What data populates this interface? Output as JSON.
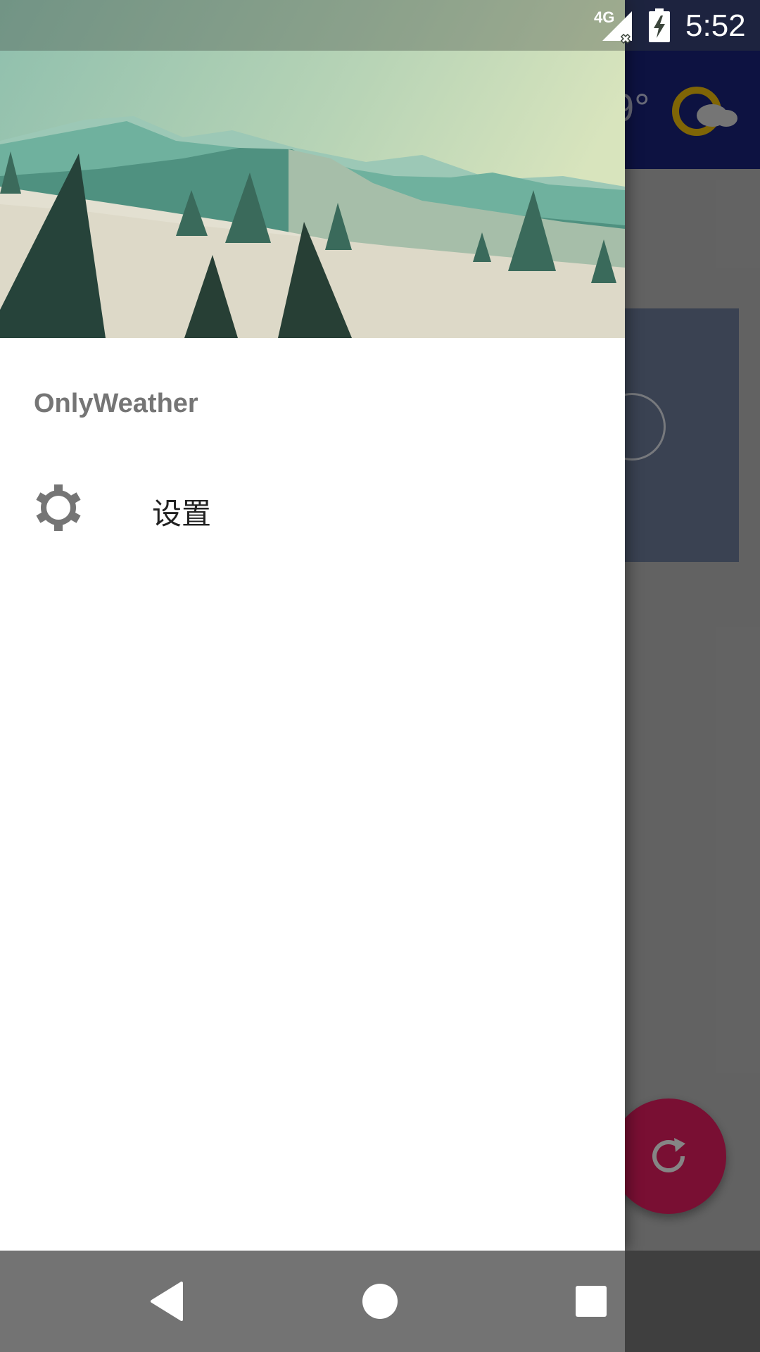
{
  "status_bar": {
    "network": "4G",
    "time": "5:52",
    "icons": [
      "signal-no-data-icon",
      "battery-charging-icon"
    ]
  },
  "background_app": {
    "temperature": "9°",
    "weather_icon": "sun-cloud-icon",
    "fab_icon": "refresh-icon",
    "colors": {
      "appbar": "#1a237e",
      "fab": "#e91e63"
    }
  },
  "drawer": {
    "header_image": "snowy-mountain-forest-illustration",
    "app_name": "OnlyWeather",
    "menu": [
      {
        "icon": "gear-icon",
        "label": "设置"
      }
    ]
  },
  "nav_bar": {
    "buttons": [
      "back-icon",
      "home-icon",
      "recents-icon"
    ]
  }
}
